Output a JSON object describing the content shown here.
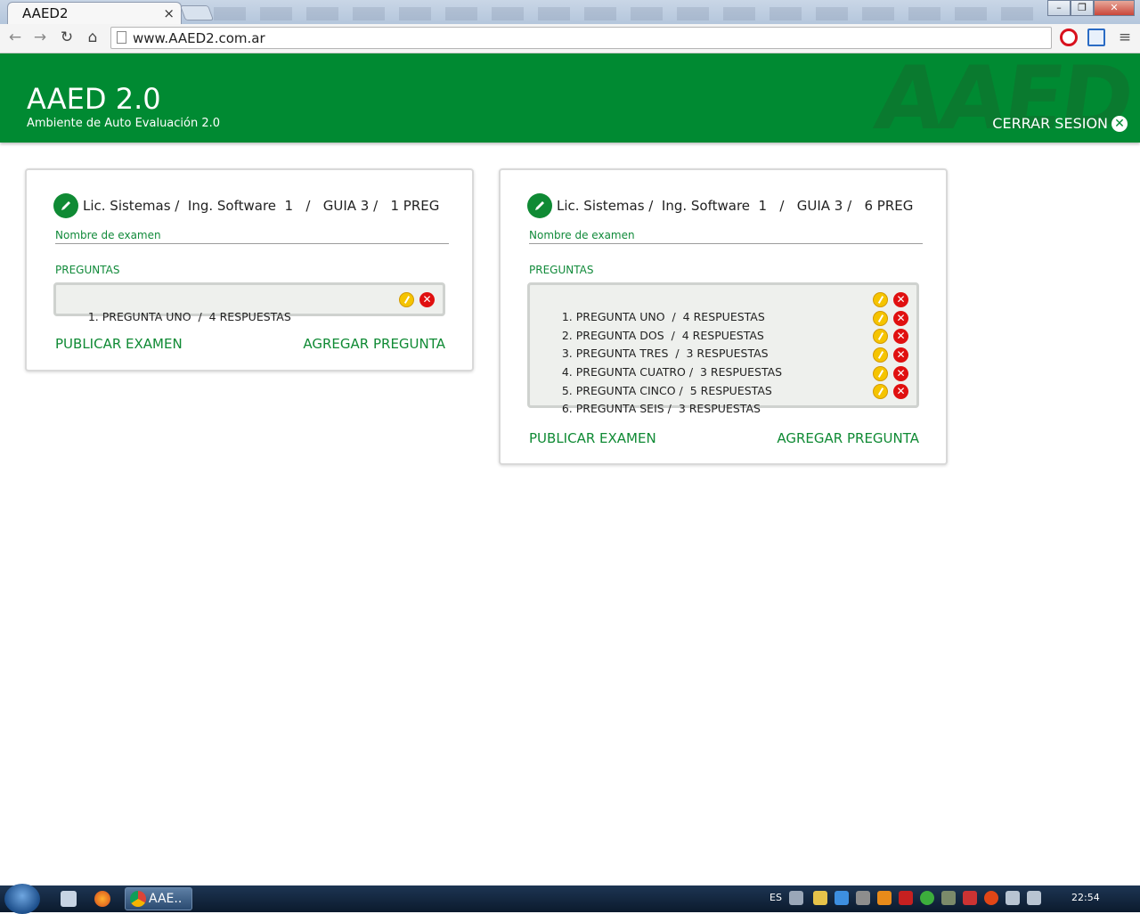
{
  "browser": {
    "tab_title": "AAED2",
    "tab_close": "×",
    "url": "www.AAED2.com.ar",
    "window_buttons": [
      "–",
      "❐",
      "✕"
    ]
  },
  "header": {
    "title": "AAED 2.0",
    "subtitle": "Ambiente de Auto Evaluación 2.0",
    "watermark": "AAED",
    "logout_label": "CERRAR SESION",
    "logout_icon": "close-circle-icon",
    "brand_color": "#008a32"
  },
  "cards": [
    {
      "breadcrumb": "Lic. Sistemas /  Ing. Software  1   /   GUIA 3 /   1 PREG",
      "exam_name_label": "Nombre de examen",
      "questions_label": "PREGUNTAS",
      "questions": [
        "1. PREGUNTA UNO  /  4 RESPUESTAS"
      ],
      "publish_label": "PUBLICAR EXAMEN",
      "add_label": "AGREGAR PREGUNTA"
    },
    {
      "breadcrumb": "Lic. Sistemas /  Ing. Software  1   /   GUIA 3 /   6 PREG",
      "exam_name_label": "Nombre de examen",
      "questions_label": "PREGUNTAS",
      "questions": [
        "1. PREGUNTA UNO  /  4 RESPUESTAS",
        "2. PREGUNTA DOS  /  4 RESPUESTAS",
        "3. PREGUNTA TRES  /  3 RESPUESTAS",
        "4. PREGUNTA CUATRO /  3 RESPUESTAS",
        "5. PREGUNTA CINCO /  5 RESPUESTAS",
        "6. PREGUNTA SEIS /  3 RESPUESTAS"
      ],
      "publish_label": "PUBLICAR EXAMEN",
      "add_label": "AGREGAR PREGUNTA"
    }
  ],
  "taskbar": {
    "app_label": "AAE..",
    "language": "ES",
    "clock": "22:54"
  }
}
